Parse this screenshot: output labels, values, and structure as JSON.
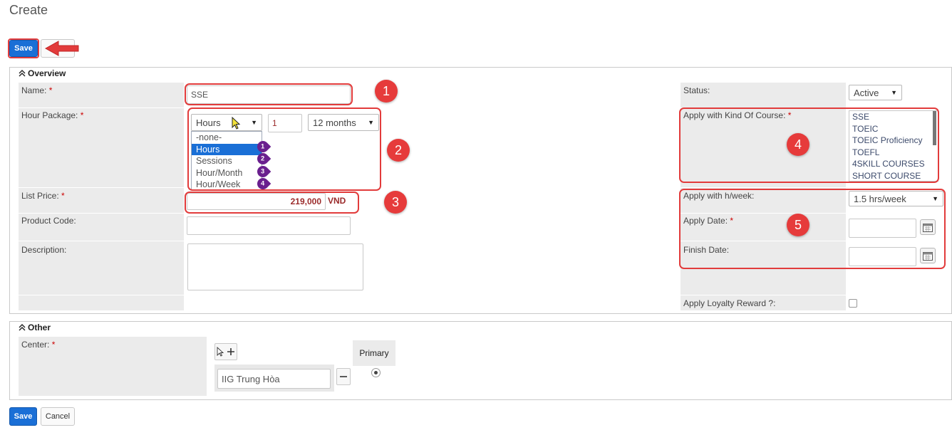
{
  "page": {
    "title": "Create"
  },
  "toolbar": {
    "save_label": "Save",
    "cancel_label": "Cancel"
  },
  "overview": {
    "section_title": "Overview",
    "name_label": "Name:",
    "name_value": "SSE",
    "hour_package_label": "Hour Package:",
    "hour_package": {
      "unit_selected": "Hours",
      "quantity": "1",
      "duration_selected": "12 months",
      "unit_options": [
        "-none-",
        "Hours",
        "Sessions",
        "Hour/Month",
        "Hour/Week"
      ]
    },
    "list_price_label": "List Price:",
    "list_price_value": "219,000",
    "currency": "VND",
    "product_code_label": "Product Code:",
    "description_label": "Description:",
    "status_label": "Status:",
    "status_value": "Active",
    "kind_of_course_label": "Apply with Kind Of Course:",
    "kind_of_course_options": [
      "SSE",
      "TOEIC",
      "TOEIC Proficiency",
      "TOEFL",
      "4SKILL COURSES",
      "SHORT COURSE"
    ],
    "hweek_label": "Apply with h/week:",
    "hweek_value": "1.5 hrs/week",
    "apply_date_label": "Apply Date:",
    "finish_date_label": "Finish Date:",
    "loyalty_label": "Apply Loyalty Reward ?:"
  },
  "other": {
    "section_title": "Other",
    "center_label": "Center:",
    "primary_header": "Primary",
    "center_value": "IIG Trung Hòa"
  },
  "annotations": {
    "callouts": [
      "1",
      "2",
      "3",
      "4",
      "5"
    ],
    "pins": [
      "1",
      "2",
      "3",
      "4"
    ]
  },
  "colors": {
    "primary_button": "#1a6fd6",
    "annotation_red": "#e23b3b",
    "pin_purple": "#6a1f8e",
    "label_bg": "#ebebeb",
    "price_text": "#9b2b2b"
  },
  "icons": {
    "collapse": "double-chevron-up-icon",
    "calendar": "calendar-icon",
    "cursor": "cursor-icon",
    "arrow": "red-arrow-icon"
  }
}
